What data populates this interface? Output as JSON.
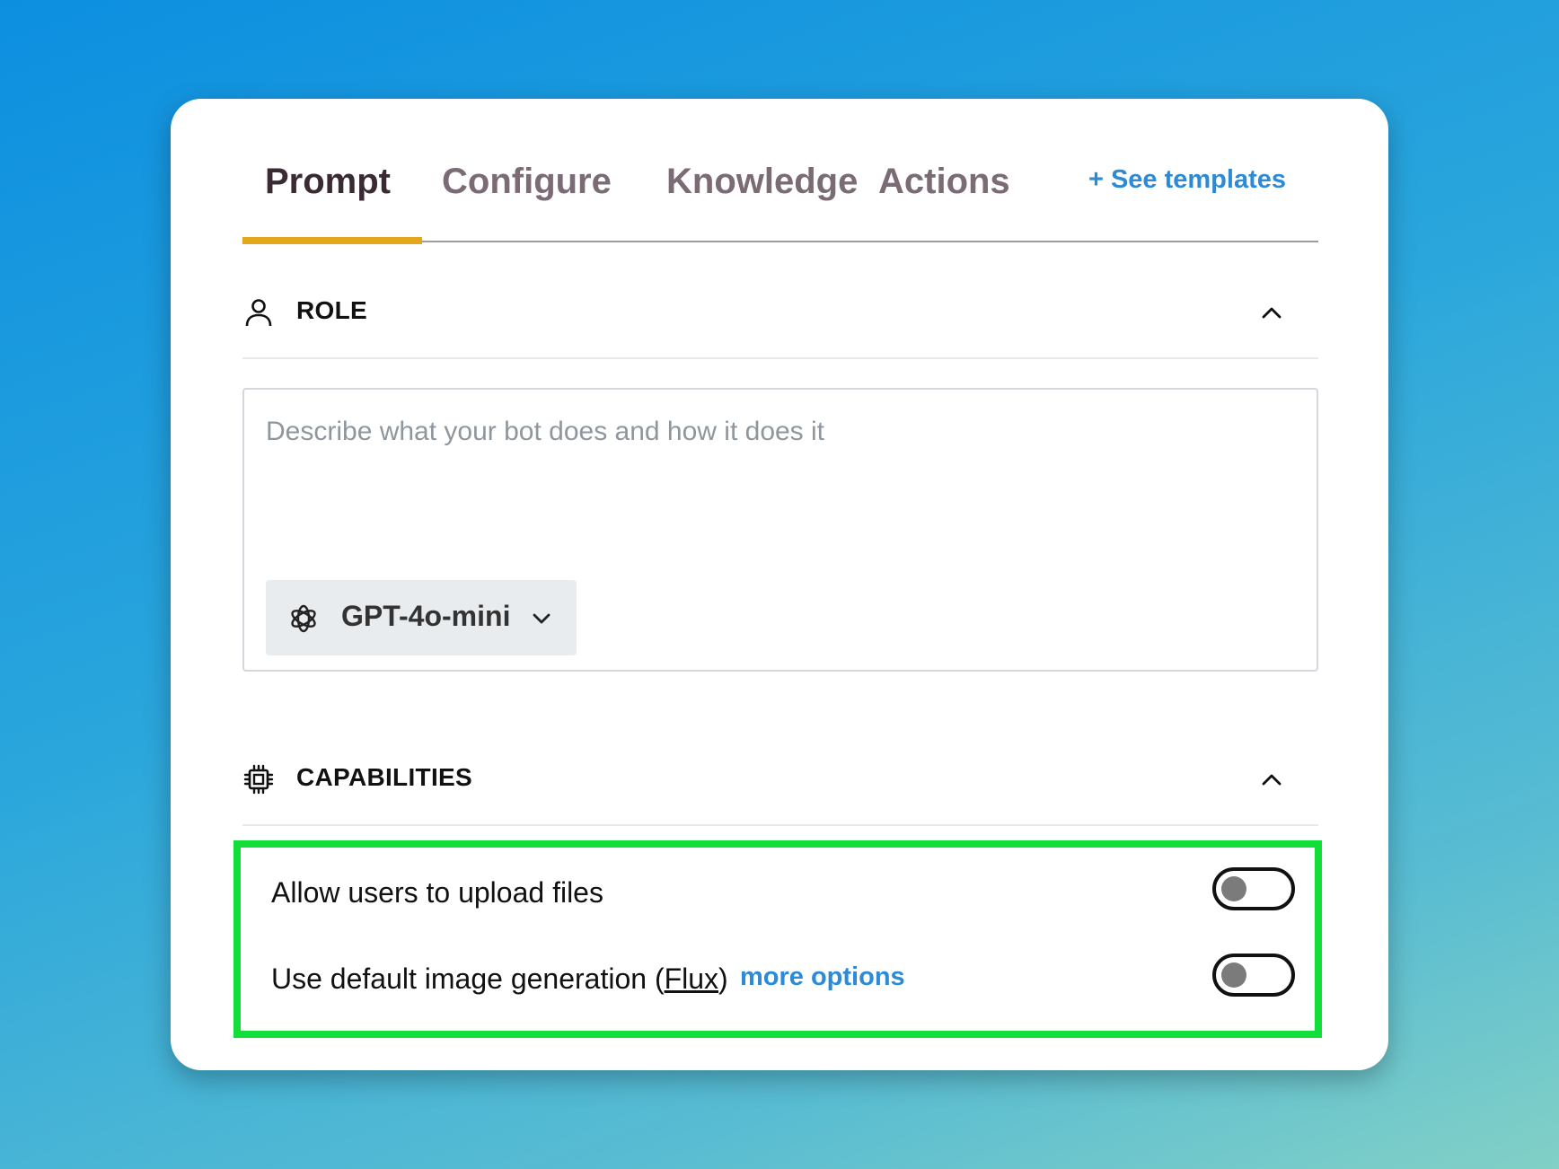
{
  "tabs": [
    {
      "label": "Prompt",
      "active": true
    },
    {
      "label": "Configure",
      "active": false
    },
    {
      "label": "Knowledge",
      "active": false
    },
    {
      "label": "Actions",
      "active": false
    }
  ],
  "see_templates_label": "+ See templates",
  "role": {
    "title": "ROLE",
    "icon": "user-icon",
    "textarea_placeholder": "Describe what your bot does and how it does it",
    "textarea_value": "",
    "model": {
      "label": "GPT-4o-mini",
      "icon": "openai-icon"
    }
  },
  "capabilities": {
    "title": "CAPABILITIES",
    "icon": "chip-icon",
    "items": [
      {
        "label": "Allow users to upload files",
        "enabled": false
      },
      {
        "label_prefix": "Use default image generation (",
        "link": "Flux",
        "label_suffix": ")",
        "more_options": "more options",
        "enabled": false
      }
    ]
  },
  "colors": {
    "accent_tab": "#e4a61a",
    "link": "#2c8ad6",
    "highlight": "#12de3a"
  }
}
